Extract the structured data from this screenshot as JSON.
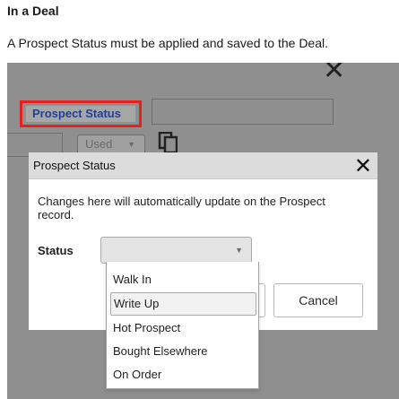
{
  "doc": {
    "heading": "In a Deal",
    "text": "A Prospect Status must be applied and saved to the Deal."
  },
  "background": {
    "close_glyph": "✕",
    "prospect_status_label": "Prospect Status",
    "used_select_value": "Used",
    "highlight_color": "#e22222",
    "label_color": "#1f3fa0"
  },
  "dialog": {
    "title": "Prospect Status",
    "close_glyph": "✕",
    "message": "Changes here will automatically update on the Prospect record.",
    "status_label": "Status",
    "status_value": "",
    "cancel_label": "Cancel",
    "options": [
      "Walk In",
      "Write Up",
      "Hot Prospect",
      "Bought Elsewhere",
      "On Order"
    ],
    "highlighted_option": "Write Up"
  },
  "icons": {
    "caret": "caret-down-icon",
    "copy": "copy-icon",
    "close": "close-icon"
  }
}
